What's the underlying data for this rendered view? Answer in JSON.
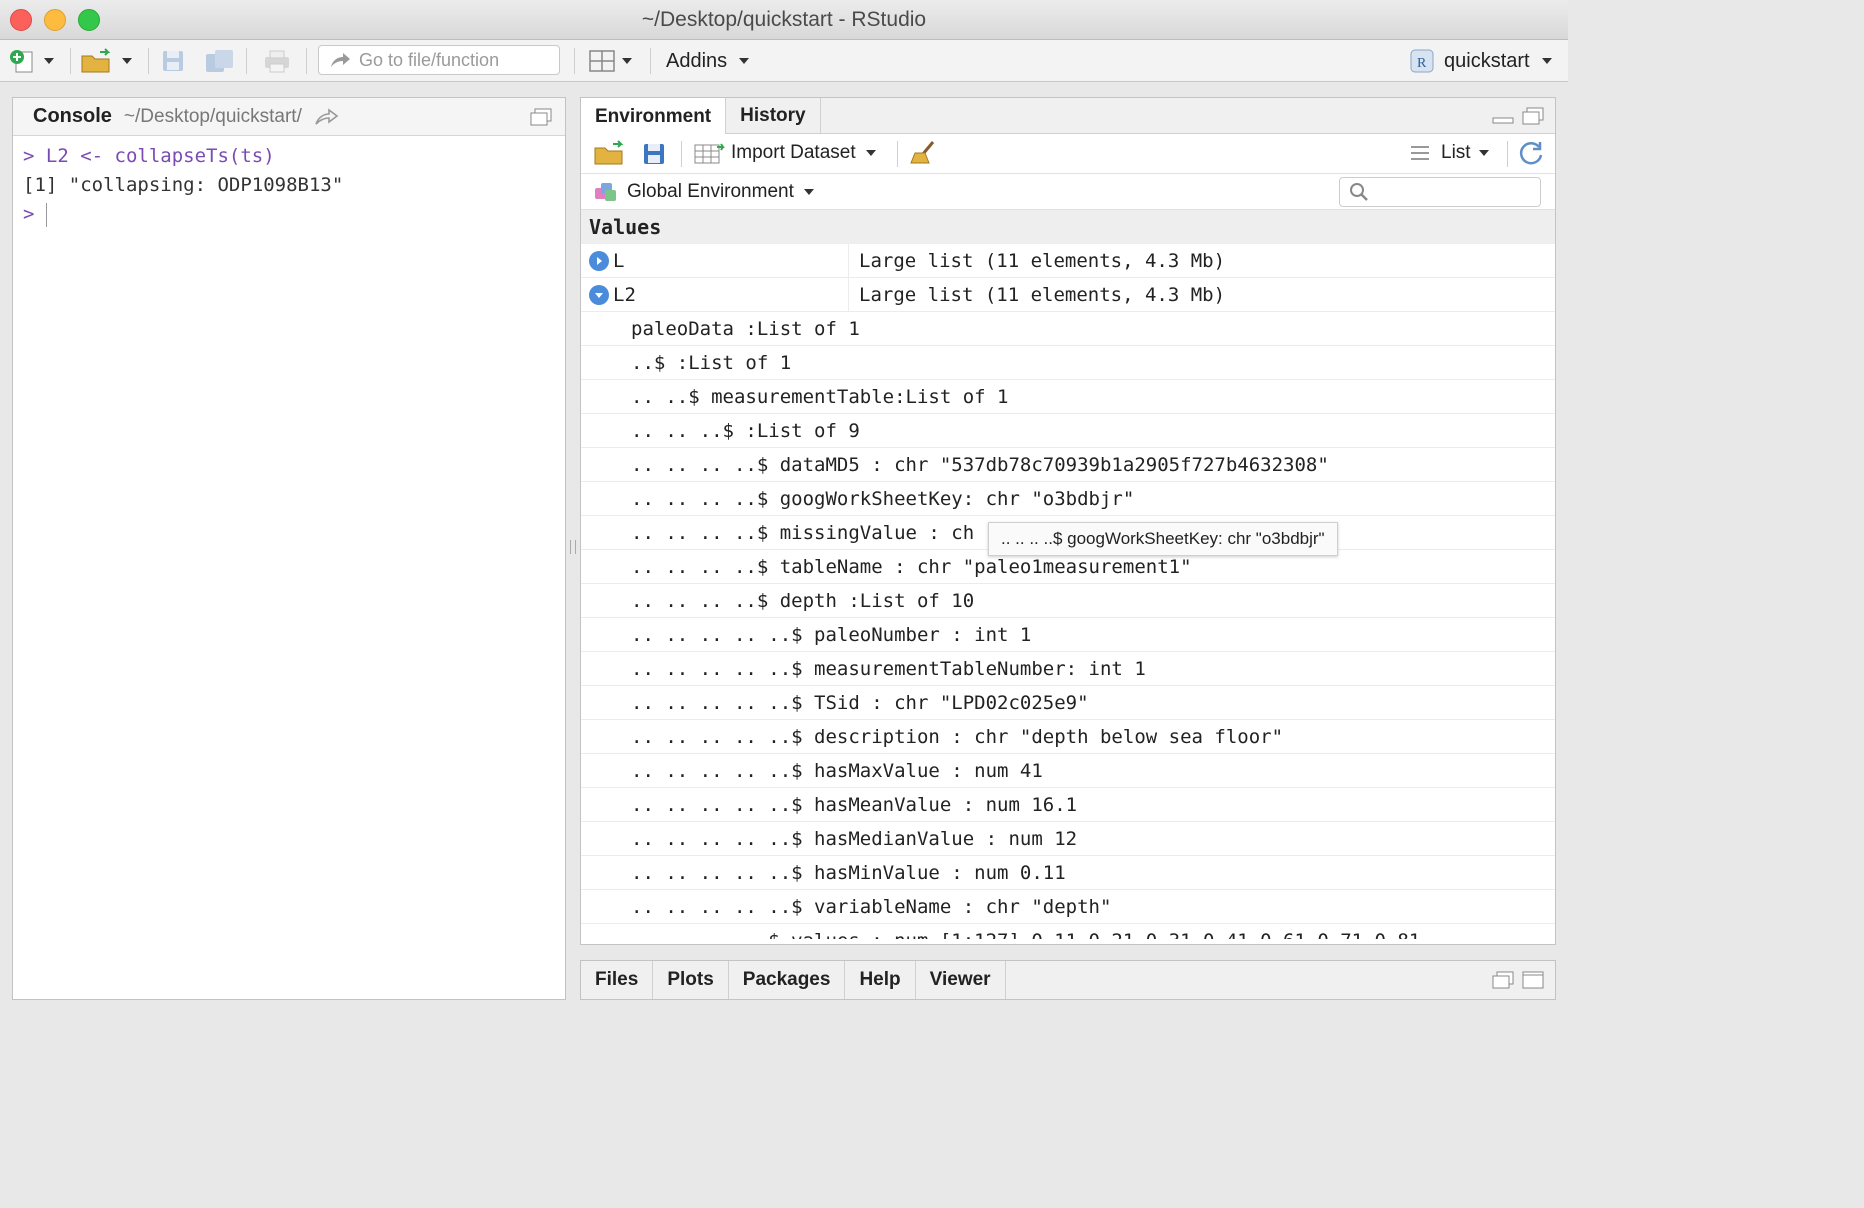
{
  "window": {
    "title": "~/Desktop/quickstart - RStudio"
  },
  "toolbar": {
    "goto_placeholder": "Go to file/function",
    "addins_label": "Addins",
    "project_label": "quickstart"
  },
  "console": {
    "title": "Console",
    "path": "~/Desktop/quickstart/",
    "lines": [
      {
        "prompt": ">",
        "text": "L2 <- collapseTs(ts)"
      },
      {
        "text": "[1] \"collapsing: ODP1098B13\""
      }
    ],
    "active_prompt": ">"
  },
  "environment": {
    "tabs": [
      "Environment",
      "History"
    ],
    "import_dataset_label": "Import Dataset",
    "view_label": "List",
    "scope_label": "Global Environment",
    "search_placeholder": "",
    "values_header": "Values",
    "objects": [
      {
        "name": "L",
        "value": "Large list (11 elements, 4.3 Mb)",
        "expanded": false
      },
      {
        "name": "L2",
        "value": "Large list (11 elements, 4.3 Mb)",
        "expanded": true
      }
    ],
    "tree": [
      "paleoData :List of 1",
      "..$ :List of 1",
      ".. ..$ measurementTable:List of 1",
      ".. .. ..$ :List of 9",
      ".. .. .. ..$ dataMD5 : chr \"537db78c70939b1a2905f727b4632308\"",
      ".. .. .. ..$ googWorkSheetKey: chr \"o3bdbjr\"",
      ".. .. .. ..$ missingValue : ch",
      ".. .. .. ..$ tableName : chr \"paleo1measurement1\"",
      ".. .. .. ..$ depth :List of 10",
      ".. .. .. .. ..$ paleoNumber : int 1",
      ".. .. .. .. ..$ measurementTableNumber: int 1",
      ".. .. .. .. ..$ TSid : chr \"LPD02c025e9\"",
      ".. .. .. .. ..$ description : chr \"depth below sea floor\"",
      ".. .. .. .. ..$ hasMaxValue : num 41",
      ".. .. .. .. ..$ hasMeanValue : num 16.1",
      ".. .. .. .. ..$ hasMedianValue : num 12",
      ".. .. .. .. ..$ hasMinValue : num 0.11",
      ".. .. .. .. ..$ variableName : chr \"depth\"",
      "            $ values : num [1:127] 0.11 0.21 0.31 0.41 0.61 0.71 0.81"
    ],
    "tooltip": ".. .. .. ..$ googWorkSheetKey: chr \"o3bdbjr\""
  },
  "files_pane": {
    "tabs": [
      "Files",
      "Plots",
      "Packages",
      "Help",
      "Viewer"
    ]
  },
  "colors": {
    "accent": "#4a8cdb",
    "console_cmd": "#7a4bb3"
  }
}
